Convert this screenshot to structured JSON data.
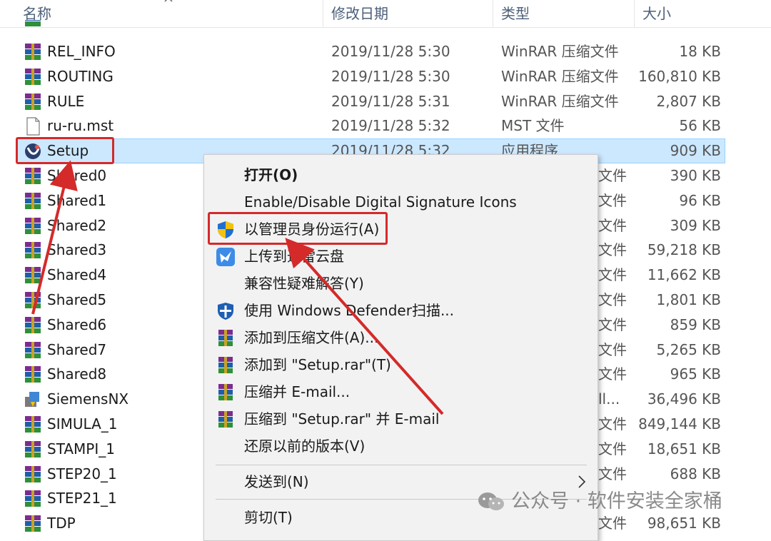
{
  "header": {
    "col_name": "名称",
    "col_date": "修改日期",
    "col_type": "类型",
    "col_size": "大小"
  },
  "files": [
    {
      "name": "REL_INFO",
      "date": "2019/11/28 5:30",
      "type": "WinRAR 压缩文件",
      "size": "18 KB",
      "icon": "winrar-archive-icon"
    },
    {
      "name": "ROUTING",
      "date": "2019/11/28 5:30",
      "type": "WinRAR 压缩文件",
      "size": "160,810 KB",
      "icon": "winrar-archive-icon"
    },
    {
      "name": "RULE",
      "date": "2019/11/28 5:31",
      "type": "WinRAR 压缩文件",
      "size": "2,807 KB",
      "icon": "winrar-archive-icon"
    },
    {
      "name": "ru-ru.mst",
      "date": "2019/11/28 5:32",
      "type": "MST 文件",
      "size": "56 KB",
      "icon": "blank-file-icon"
    },
    {
      "name": "Setup",
      "date": "2019/11/28 5:32",
      "type": "应用程序",
      "size": "909 KB",
      "icon": "setup-app-icon"
    },
    {
      "name": "Shared0",
      "date": "",
      "type": "文件",
      "size": "390 KB",
      "icon": "winrar-archive-icon"
    },
    {
      "name": "Shared1",
      "date": "",
      "type": "文件",
      "size": "96 KB",
      "icon": "winrar-archive-icon"
    },
    {
      "name": "Shared2",
      "date": "",
      "type": "文件",
      "size": "309 KB",
      "icon": "winrar-archive-icon"
    },
    {
      "name": "Shared3",
      "date": "",
      "type": "文件",
      "size": "59,218 KB",
      "icon": "winrar-archive-icon"
    },
    {
      "name": "Shared4",
      "date": "",
      "type": "文件",
      "size": "11,662 KB",
      "icon": "winrar-archive-icon"
    },
    {
      "name": "Shared5",
      "date": "",
      "type": "文件",
      "size": "1,801 KB",
      "icon": "winrar-archive-icon"
    },
    {
      "name": "Shared6",
      "date": "",
      "type": "文件",
      "size": "859 KB",
      "icon": "winrar-archive-icon"
    },
    {
      "name": "Shared7",
      "date": "",
      "type": "文件",
      "size": "5,265 KB",
      "icon": "winrar-archive-icon"
    },
    {
      "name": "Shared8",
      "date": "",
      "type": "文件",
      "size": "965 KB",
      "icon": "winrar-archive-icon"
    },
    {
      "name": "SiemensNX",
      "date": "",
      "type": "ll...",
      "size": "36,496 KB",
      "icon": "installer-package-icon"
    },
    {
      "name": "SIMULA_1",
      "date": "",
      "type": "文件",
      "size": "849,144 KB",
      "icon": "winrar-archive-icon"
    },
    {
      "name": "STAMPI_1",
      "date": "",
      "type": "文件",
      "size": "18,651 KB",
      "icon": "winrar-archive-icon"
    },
    {
      "name": "STEP20_1",
      "date": "",
      "type": "文件",
      "size": "688 KB",
      "icon": "winrar-archive-icon"
    },
    {
      "name": "STEP21_1",
      "date": "",
      "type": "",
      "size": "",
      "icon": "winrar-archive-icon"
    },
    {
      "name": "TDP",
      "date": "",
      "type": "文件",
      "size": "98,651 KB",
      "icon": "winrar-archive-icon"
    }
  ],
  "context_menu": {
    "open": "打开(O)",
    "sig_icons": "Enable/Disable Digital Signature Icons",
    "run_as_admin": "以管理员身份运行(A)",
    "upload_xunlei": "上传到迅雷云盘",
    "compat": "兼容性疑难解答(Y)",
    "defender": "使用 Windows Defender扫描...",
    "add_archive": "添加到压缩文件(A)...",
    "add_to_rar": "添加到 \"Setup.rar\"(T)",
    "compress_email": "压缩并 E-mail...",
    "compress_rar_email": "压缩到 \"Setup.rar\" 并 E-mail",
    "restore_prev": "还原以前的版本(V)",
    "send_to": "发送到(N)",
    "cut": "剪切(T)"
  },
  "watermark": {
    "text": "公众号 · 软件安装全家桶"
  },
  "colors": {
    "annotation_red": "#d42a2a",
    "selection_bg": "#cce8ff"
  }
}
